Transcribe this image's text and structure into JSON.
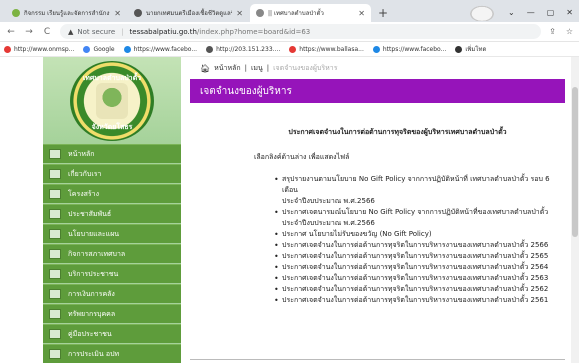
{
  "browser": {
    "tabs": [
      {
        "title": "กิจกรรม เรียนรู้และจัดการสำนักงานสมัยใหม่",
        "favicon_color": "#7cb342",
        "active": false
      },
      {
        "title": "นายกเทศมนตรีเมืองเชื้อชีวิตดูแลรักษา",
        "favicon_color": "#555555",
        "active": false
      },
      {
        "title": "|| เทศบาลตำบลป่าตั้ว",
        "favicon_color": "#888888",
        "active": true
      }
    ],
    "new_tab": "+",
    "close_glyph": "✕",
    "window_controls": [
      "⌄",
      "—",
      "▢",
      "✕"
    ]
  },
  "addressbar": {
    "back": "←",
    "forward": "→",
    "reload": "C",
    "warning": "▲",
    "security_label": "Not secure",
    "separator": "|",
    "host": "tessabalpatiu.go.th",
    "path": "/index.php?home=board&id=63",
    "share": "⇪",
    "star": "☆"
  },
  "bookmarks": [
    {
      "label": "http://www.onmsp...",
      "color": "#e53935"
    },
    {
      "label": "Google",
      "color": "#4285f4"
    },
    {
      "label": "https://www.facebo...",
      "color": "#1e88e5"
    },
    {
      "label": "http://203.151.233....",
      "color": "#555555"
    },
    {
      "label": "https://www.ballasa...",
      "color": "#e53935"
    },
    {
      "label": "https://www.facebo...",
      "color": "#1e88e5"
    },
    {
      "label": "เพิ่มโทด",
      "color": "#333333"
    }
  ],
  "site": {
    "logo_top": "เทศบาลตำบลป่าตั้ว",
    "logo_bottom": "จังหวัดยโสธร",
    "menu": [
      "หน้าหลัก",
      "เกี่ยวกับเรา",
      "โครงสร้าง",
      "ประชาสัมพันธ์",
      "นโยบายและแผน",
      "กิจการสภาเทศบาล",
      "บริการประชาชน",
      "การเงินการคลัง",
      "ทรัพยากรบุคคล",
      "คู่มือประชาชน",
      "การประเมิน อปท"
    ]
  },
  "breadcrumb": {
    "home": "หน้าหลัก",
    "sep": "|",
    "menu": "เมนู",
    "current": "เจตจำนงของผู้บริหาร"
  },
  "banner_title": "เจตจำนงของผู้บริหาร",
  "heading": "ประกาศเจตจำนงในการต่อต้านการทุจริตของผู้บริหารเทศบาลตำบลป่าตั้ว",
  "subnote": "เลือกลิงค์ด้านล่าง เพื่อแสดงไฟล์",
  "documents": [
    "สรุปรายงานตามนโยบาย No Gift Policy จากการปฏิบัติหน้าที่ เทศบาลตำบลป่าตั้ว รอบ 6 เดือน",
    "ประจำปีงบประมาณ พ.ศ.2566",
    "ประกาศเจตนารมณ์นโยบาย No Gift Policy จากการปฏิบัติหน้าที่ของเทศบาลตำบลป่าตั้ว",
    "ประจำปีงบประมาณ พ.ศ.2566",
    "ประกาศ นโยบายไม่รับของขวัญ (No Gift Policy)",
    "ประกาศเจตจำนงในการต่อต้านการทุจริตในการบริหารงานของเทศบาลตำบลป่าตั้ว 2566",
    "ประกาศเจตจำนงในการต่อต้านการทุจริตในการบริหารงานของเทศบาลตำบลป่าตั้ว 2565",
    "ประกาศเจตจำนงในการต่อต้านการทุจริตในการบริหารงานของเทศบาลตำบลป่าตั้ว 2564",
    "ประกาศเจตจำนงในการต่อต้านการทุจริตในการบริหารงานของเทศบาลตำบลป่าตั้ว 2563",
    "ประกาศเจตจำนงในการต่อต้านการทุจริตในการบริหารงานของเทศบาลตำบลป่าตั้ว 2562",
    "ประกาศเจตจำนงในการต่อต้านการทุจริตในการบริหารงานของเทศบาลตำบลป่าตั้ว 2561"
  ],
  "colors": {
    "banner": "#9614ba",
    "sidebar": "#a5d29a",
    "menu_item": "#5e9c3b"
  }
}
